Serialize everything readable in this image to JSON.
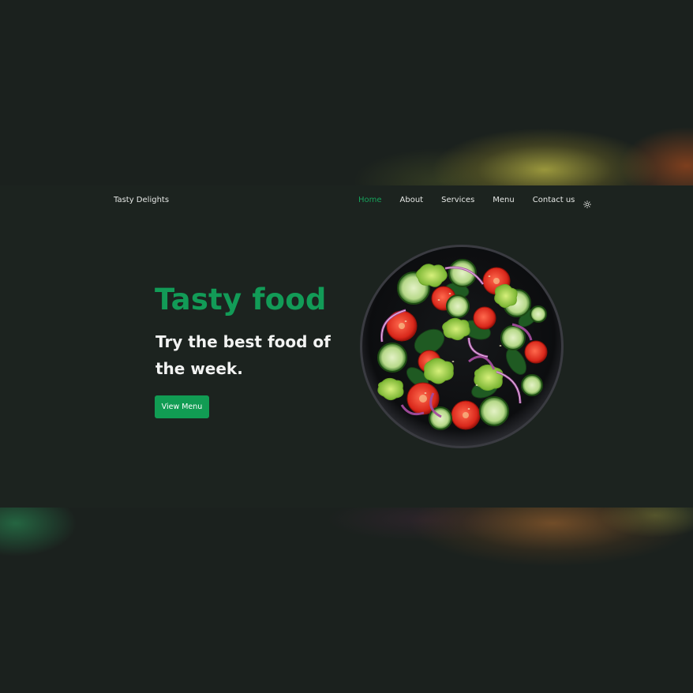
{
  "header": {
    "brand": "Tasty Delights"
  },
  "nav": {
    "items": [
      {
        "label": "Home",
        "active": true
      },
      {
        "label": "About",
        "active": false
      },
      {
        "label": "Services",
        "active": false
      },
      {
        "label": "Menu",
        "active": false
      },
      {
        "label": "Contact us",
        "active": false
      }
    ],
    "theme_toggle_icon": "sun-icon"
  },
  "hero": {
    "title": "Tasty food",
    "subtitle": "Try the best food of the week.",
    "cta_label": "View Menu",
    "image_subject": "salad-bowl"
  },
  "colors": {
    "accent": "#119c53",
    "background": "#1c231f",
    "text": "#e6e8e6"
  }
}
